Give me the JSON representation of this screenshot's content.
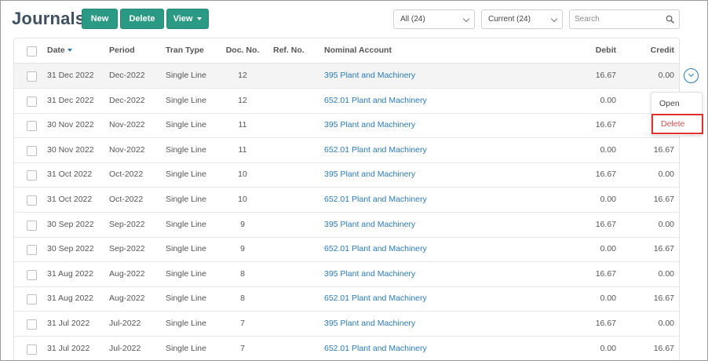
{
  "page": {
    "title": "Journals"
  },
  "toolbar": {
    "new_label": "New",
    "delete_label": "Delete",
    "view_label": "View",
    "filter_all": "All (24)",
    "filter_current": "Current (24)",
    "search_placeholder": "Search"
  },
  "colors": {
    "primary_button": "#2a9a84",
    "link": "#2b7ab8",
    "danger": "#d9534f",
    "highlight_border": "#e03131"
  },
  "table": {
    "headers": {
      "date": "Date",
      "period": "Period",
      "tran_type": "Tran Type",
      "doc_no": "Doc. No.",
      "ref_no": "Ref. No.",
      "nominal_account": "Nominal Account",
      "debit": "Debit",
      "credit": "Credit"
    },
    "sort": {
      "column": "date",
      "direction": "descending"
    },
    "rows": [
      {
        "date": "31 Dec 2022",
        "period": "Dec-2022",
        "type": "Single Line",
        "doc": "12",
        "ref": "",
        "account": "395 Plant and Machinery",
        "debit": "16.67",
        "credit": "0.00"
      },
      {
        "date": "31 Dec 2022",
        "period": "Dec-2022",
        "type": "Single Line",
        "doc": "12",
        "ref": "",
        "account": "652.01 Plant and Machinery",
        "debit": "0.00",
        "credit": ""
      },
      {
        "date": "30 Nov 2022",
        "period": "Nov-2022",
        "type": "Single Line",
        "doc": "11",
        "ref": "",
        "account": "395 Plant and Machinery",
        "debit": "16.67",
        "credit": ""
      },
      {
        "date": "30 Nov 2022",
        "period": "Nov-2022",
        "type": "Single Line",
        "doc": "11",
        "ref": "",
        "account": "652.01 Plant and Machinery",
        "debit": "0.00",
        "credit": "16.67"
      },
      {
        "date": "31 Oct 2022",
        "period": "Oct-2022",
        "type": "Single Line",
        "doc": "10",
        "ref": "",
        "account": "395 Plant and Machinery",
        "debit": "16.67",
        "credit": "0.00"
      },
      {
        "date": "31 Oct 2022",
        "period": "Oct-2022",
        "type": "Single Line",
        "doc": "10",
        "ref": "",
        "account": "652.01 Plant and Machinery",
        "debit": "0.00",
        "credit": "16.67"
      },
      {
        "date": "30 Sep 2022",
        "period": "Sep-2022",
        "type": "Single Line",
        "doc": "9",
        "ref": "",
        "account": "395 Plant and Machinery",
        "debit": "16.67",
        "credit": "0.00"
      },
      {
        "date": "30 Sep 2022",
        "period": "Sep-2022",
        "type": "Single Line",
        "doc": "9",
        "ref": "",
        "account": "652.01 Plant and Machinery",
        "debit": "0.00",
        "credit": "16.67"
      },
      {
        "date": "31 Aug 2022",
        "period": "Aug-2022",
        "type": "Single Line",
        "doc": "8",
        "ref": "",
        "account": "395 Plant and Machinery",
        "debit": "16.67",
        "credit": "0.00"
      },
      {
        "date": "31 Aug 2022",
        "period": "Aug-2022",
        "type": "Single Line",
        "doc": "8",
        "ref": "",
        "account": "652.01 Plant and Machinery",
        "debit": "0.00",
        "credit": "16.67"
      },
      {
        "date": "31 Jul 2022",
        "period": "Jul-2022",
        "type": "Single Line",
        "doc": "7",
        "ref": "",
        "account": "395 Plant and Machinery",
        "debit": "16.67",
        "credit": "0.00"
      },
      {
        "date": "31 Jul 2022",
        "period": "Jul-2022",
        "type": "Single Line",
        "doc": "7",
        "ref": "",
        "account": "652.01 Plant and Machinery",
        "debit": "0.00",
        "credit": "16.67"
      }
    ]
  },
  "row_menu": {
    "open_label": "Open",
    "delete_label": "Delete"
  },
  "icons": {
    "search": "search-icon",
    "row_action": "chevron-down-icon",
    "sort": "sort-desc-icon",
    "dropdown": "chevron-down-icon"
  }
}
